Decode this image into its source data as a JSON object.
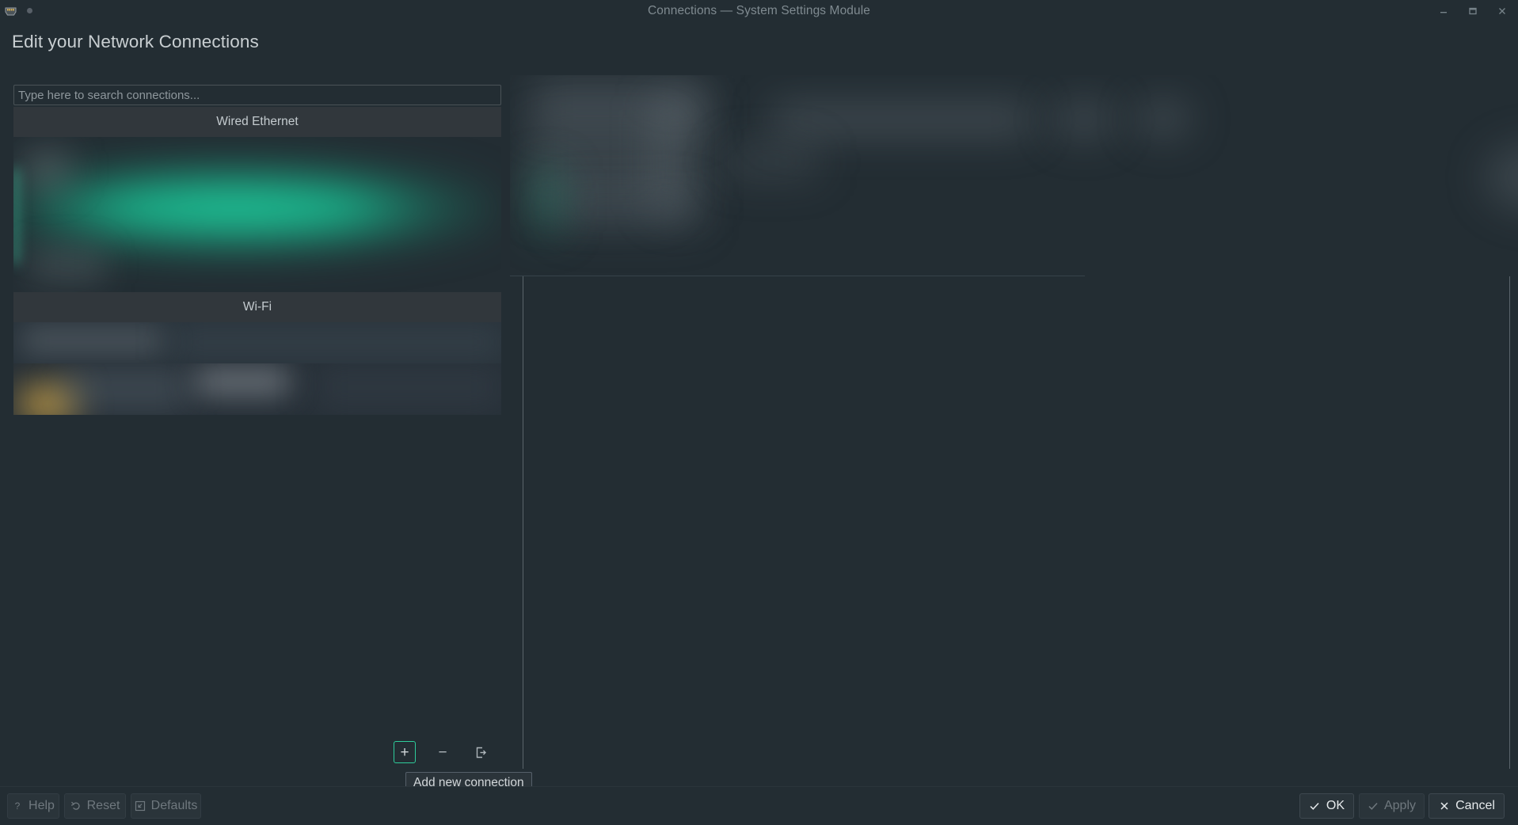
{
  "window": {
    "title": "Connections — System Settings Module",
    "app_icon": "ethernet-port-icon",
    "controls": {
      "minimize": "minimize-icon",
      "maximize": "maximize-icon",
      "close": "close-icon"
    }
  },
  "page": {
    "heading": "Edit your Network Connections"
  },
  "search": {
    "placeholder": "Type here to search connections...",
    "value": ""
  },
  "connection_list": {
    "groups": [
      {
        "label": "Wired Ethernet",
        "items": [
          {
            "name": "connection-item-wired-1",
            "state": "selected",
            "redacted": true
          }
        ]
      },
      {
        "label": "Wi-Fi",
        "items": [
          {
            "name": "connection-item-wifi-1",
            "state": "normal",
            "redacted": true
          },
          {
            "name": "connection-item-wifi-2",
            "state": "normal",
            "redacted": true
          }
        ]
      }
    ]
  },
  "list_toolbar": {
    "add": {
      "label": "+",
      "icon": "plus-icon",
      "focused": true
    },
    "remove": {
      "label": "−",
      "icon": "minus-icon",
      "focused": false
    },
    "export": {
      "icon": "export-icon",
      "focused": false
    }
  },
  "tooltip": {
    "text": "Add new connection"
  },
  "detail_panel": {
    "redacted": true
  },
  "bottom_bar": {
    "help": {
      "label": "Help",
      "icon": "question-mark-icon",
      "enabled": true
    },
    "reset": {
      "label": "Reset",
      "icon": "undo-arrow-icon",
      "enabled": true
    },
    "defaults": {
      "label": "Defaults",
      "icon": "restore-defaults-icon",
      "enabled": true
    },
    "ok": {
      "label": "OK",
      "icon": "checkmark-icon",
      "enabled": true
    },
    "apply": {
      "label": "Apply",
      "icon": "checkmark-icon",
      "enabled": false
    },
    "cancel": {
      "label": "Cancel",
      "icon": "cross-icon",
      "enabled": true
    }
  },
  "colors": {
    "background": "#232d33",
    "group_header": "#31373c",
    "accent_teal": "#2ecc9b",
    "selection_glow": "#1ab98f",
    "text": "#c8ccce",
    "text_dim": "#7f8a90",
    "border": "#4a5257"
  }
}
